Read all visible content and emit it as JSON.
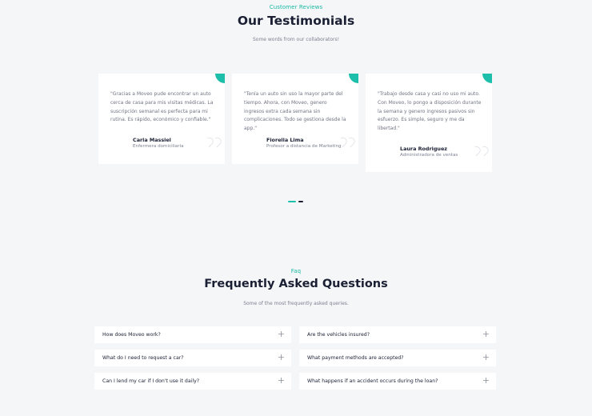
{
  "testimonials": {
    "eyebrow": "Customer Reviews",
    "title": "Our Testimonials",
    "subtitle": "Some words from our collaborators!",
    "items": [
      {
        "quote": "\"Gracias a Moveo pude encontrar un auto cerca de casa para mis visitas médicas. La suscripción semanal es perfecta para mi rutina. Es rápido, económico y confiable.\"",
        "name": "Carla Massiel",
        "role": "Enfermera domiciliaria"
      },
      {
        "quote": "\"Tenía un auto sin uso la mayor parte del tiempo. Ahora, con Moveo, genero ingresos extra cada semana sin complicaciones. Todo se gestiona desde la app.\"",
        "name": "Fiorella Lima",
        "role": "Profesor a distancia de Marketing"
      },
      {
        "quote": "\"Trabajo desde casa y casi no uso mi auto. Con Moveo, lo pongo a disposición durante la semana y genero ingresos pasivos sin esfuerzo. Es simple, seguro y me da libertad.\"",
        "name": "Laura Rodriguez",
        "role": "Administradora de ventas"
      }
    ],
    "slider": {
      "active_index": 0,
      "total": 2
    }
  },
  "faq": {
    "eyebrow": "Faq",
    "title": "Frequently Asked Questions",
    "subtitle": "Some of the most frequently asked queries.",
    "left": [
      "How does Moveo work?",
      "What do I need to request a car?",
      "Can I lend my car if I don't use it daily?"
    ],
    "right": [
      "Are the vehicles insured?",
      "What payment methods are accepted?",
      "What happens if an accident occurs during the loan?"
    ]
  },
  "colors": {
    "accent": "#1ebfaa",
    "heading": "#1a1f33",
    "background": "#f4f6f8"
  },
  "icons": {
    "quote": "quote-icon",
    "expand": "plus-icon"
  }
}
